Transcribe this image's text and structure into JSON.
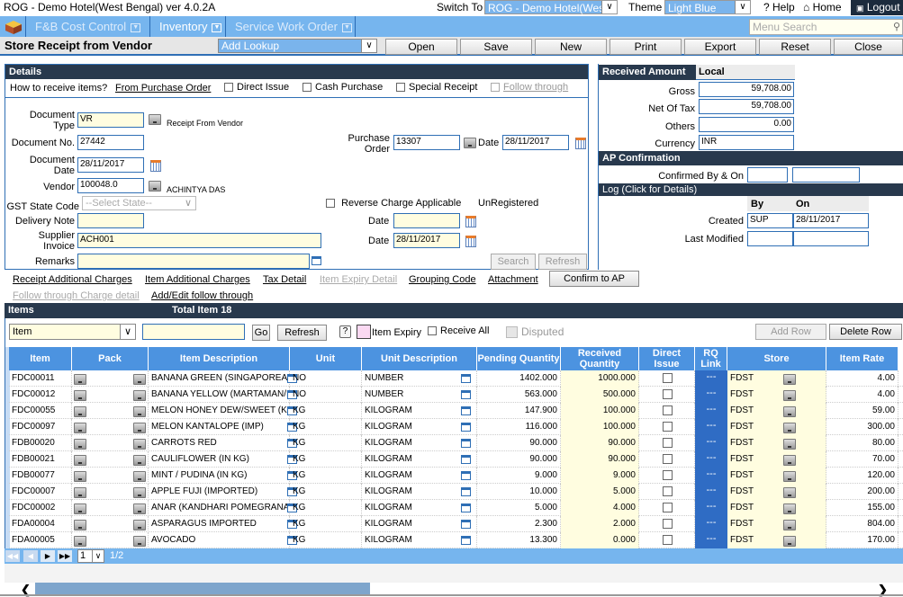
{
  "app": {
    "title": "ROG - Demo Hotel(West Bengal) ver 4.0.2A",
    "switch_to_label": "Switch To",
    "switch_to_value": "ROG - Demo Hotel(West",
    "theme_label": "Theme",
    "theme_value": "Light Blue",
    "help": "? Help",
    "home": "Home",
    "logout": "Logout"
  },
  "nav": {
    "items": [
      {
        "label": "F&B Cost Control"
      },
      {
        "label": "Inventory"
      },
      {
        "label": "Service Work Order"
      }
    ],
    "menu_search_placeholder": "Menu Search"
  },
  "toolbar": {
    "page_title": "Store Receipt from Vendor",
    "lookup": "Add Lookup",
    "buttons": [
      "Open",
      "Save",
      "New",
      "Print",
      "Export",
      "Reset",
      "Close"
    ]
  },
  "details": {
    "header": "Details",
    "how_to_receive": "How to receive items?",
    "from_po": "From Purchase Order",
    "direct_issue": "Direct Issue",
    "cash_purchase": "Cash Purchase",
    "special_receipt": "Special Receipt",
    "follow_through": "Follow through",
    "doc_type_label": "Document Type",
    "doc_type_value": "VR",
    "doc_type_desc": "Receipt From Vendor",
    "doc_no_label": "Document No.",
    "doc_no_value": "27442",
    "doc_date_label": "Document Date",
    "doc_date_value": "28/11/2017",
    "vendor_label": "Vendor",
    "vendor_value": "100048.0",
    "vendor_name": "ACHINTYA DAS",
    "gst_label": "GST State Code",
    "gst_value": "--Select State--",
    "delivery_note_label": "Delivery Note",
    "delivery_note_value": "",
    "supplier_invoice_label": "Supplier Invoice",
    "supplier_invoice_value": "ACH001",
    "remarks_label": "Remarks",
    "remarks_value": "",
    "po_label": "Purchase Order",
    "po_value": "13307",
    "po_date_label": "Date",
    "po_date_value": "28/11/2017",
    "reverse_charge": "Reverse Charge Applicable",
    "registration": "UnRegistered",
    "dn_date_label": "Date",
    "dn_date_value": "",
    "inv_date_label": "Date",
    "inv_date_value": "28/11/2017",
    "search": "Search",
    "refresh": "Refresh"
  },
  "received": {
    "header": "Received Amount",
    "local": "Local",
    "gross_label": "Gross",
    "gross": "59,708.00",
    "net_label": "Net Of Tax",
    "net": "59,708.00",
    "others_label": "Others",
    "others": "0.00",
    "currency_label": "Currency",
    "currency": "INR"
  },
  "ap": {
    "header": "AP Confirmation",
    "confirmed_label": "Confirmed By & On",
    "confirmed_by": "",
    "confirmed_on": ""
  },
  "log": {
    "header": "Log  (Click for Details)",
    "by": "By",
    "on": "On",
    "created_label": "Created",
    "created_by": "SUP",
    "created_on": "28/11/2017",
    "modified_label": "Last Modified",
    "modified_by": "",
    "modified_on": ""
  },
  "links": {
    "receipt_charges": "Receipt Additional Charges",
    "item_charges": "Item Additional Charges",
    "tax_detail": "Tax Detail",
    "item_expiry": "Item Expiry Detail",
    "grouping": "Grouping Code",
    "attachment": "Attachment",
    "confirm_ap": "Confirm to AP",
    "follow_charge": "Follow through Charge detail",
    "add_follow": "Add/Edit follow through"
  },
  "items": {
    "header": "Items",
    "total": "Total Item 18",
    "filter_field": "Item",
    "filter_value": "",
    "go": "Go",
    "refresh": "Refresh",
    "help": "?",
    "item_expiry": "Item Expiry",
    "receive_all": "Receive All",
    "disputed": "Disputed",
    "add_row": "Add Row",
    "delete_row": "Delete Row",
    "columns": [
      "Item",
      "Pack",
      "Item Description",
      "Unit",
      "Unit Description",
      "Pending Quantity",
      "Received Quantity",
      "Direct Issue",
      "RQ Link",
      "Store",
      "Item Rate"
    ],
    "rows": [
      {
        "item": "FDC00011",
        "desc": "BANANA GREEN (SINGAPOREAN",
        "unit": "NO",
        "unit_desc": "NUMBER",
        "pending": "1402.000",
        "received": "1000.000",
        "rq": "---",
        "store": "FDST",
        "rate": "4.00"
      },
      {
        "item": "FDC00012",
        "desc": "BANANA YELLOW (MARTAMAN/I",
        "unit": "NO",
        "unit_desc": "NUMBER",
        "pending": "563.000",
        "received": "500.000",
        "rq": "---",
        "store": "FDST",
        "rate": "4.00"
      },
      {
        "item": "FDC00055",
        "desc": "MELON HONEY DEW/SWEET (KH",
        "unit": "KG",
        "unit_desc": "KILOGRAM",
        "pending": "147.900",
        "received": "100.000",
        "rq": "---",
        "store": "FDST",
        "rate": "59.00"
      },
      {
        "item": "FDC00097",
        "desc": "MELON KANTALOPE (IMP)",
        "unit": "KG",
        "unit_desc": "KILOGRAM",
        "pending": "116.000",
        "received": "100.000",
        "rq": "---",
        "store": "FDST",
        "rate": "300.00"
      },
      {
        "item": "FDB00020",
        "desc": "CARROTS RED",
        "unit": "KG",
        "unit_desc": "KILOGRAM",
        "pending": "90.000",
        "received": "90.000",
        "rq": "---",
        "store": "FDST",
        "rate": "80.00"
      },
      {
        "item": "FDB00021",
        "desc": "CAULIFLOWER (IN KG)",
        "unit": "KG",
        "unit_desc": "KILOGRAM",
        "pending": "90.000",
        "received": "90.000",
        "rq": "---",
        "store": "FDST",
        "rate": "70.00"
      },
      {
        "item": "FDB00077",
        "desc": "MINT / PUDINA (IN KG)",
        "unit": "KG",
        "unit_desc": "KILOGRAM",
        "pending": "9.000",
        "received": "9.000",
        "rq": "---",
        "store": "FDST",
        "rate": "120.00"
      },
      {
        "item": "FDC00007",
        "desc": "APPLE FUJI (IMPORTED)",
        "unit": "KG",
        "unit_desc": "KILOGRAM",
        "pending": "10.000",
        "received": "5.000",
        "rq": "---",
        "store": "FDST",
        "rate": "200.00"
      },
      {
        "item": "FDC00002",
        "desc": "ANAR (KANDHARI POMEGRANAT",
        "unit": "KG",
        "unit_desc": "KILOGRAM",
        "pending": "5.000",
        "received": "4.000",
        "rq": "---",
        "store": "FDST",
        "rate": "155.00"
      },
      {
        "item": "FDA00004",
        "desc": "ASPARAGUS IMPORTED",
        "unit": "KG",
        "unit_desc": "KILOGRAM",
        "pending": "2.300",
        "received": "2.000",
        "rq": "---",
        "store": "FDST",
        "rate": "804.00"
      },
      {
        "item": "FDA00005",
        "desc": "AVOCADO",
        "unit": "KG",
        "unit_desc": "KILOGRAM",
        "pending": "13.300",
        "received": "0.000",
        "rq": "---",
        "store": "FDST",
        "rate": "170.00"
      }
    ],
    "pager": {
      "page": "1",
      "of": "1/2"
    }
  }
}
